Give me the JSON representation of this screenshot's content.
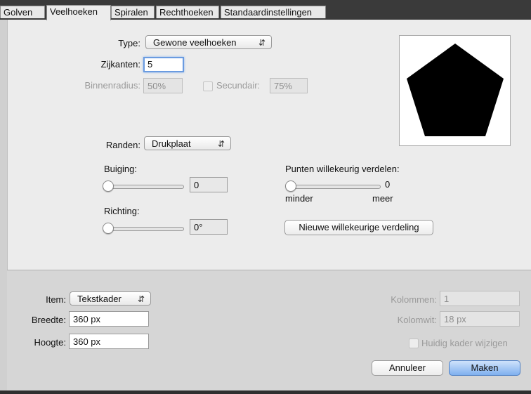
{
  "tabs": [
    {
      "label": "Golven"
    },
    {
      "label": "Veelhoeken"
    },
    {
      "label": "Spiralen"
    },
    {
      "label": "Rechthoeken"
    },
    {
      "label": "Standaardinstellingen"
    }
  ],
  "active_tab": "Veelhoeken",
  "polygon": {
    "type_label": "Type:",
    "type_value": "Gewone veelhoeken",
    "sides_label": "Zijkanten:",
    "sides_value": "5",
    "inner_radius_label": "Binnenradius:",
    "inner_radius_value": "50%",
    "secondary_label": "Secundair:",
    "secondary_value": "75%"
  },
  "edges": {
    "label": "Randen:",
    "value": "Drukplaat",
    "bend_label": "Buiging:",
    "bend_value": "0",
    "direction_label": "Richting:",
    "direction_value": "0°"
  },
  "random": {
    "label": "Punten willekeurig verdelen:",
    "value": "0",
    "min_label": "minder",
    "max_label": "meer",
    "new_button": "Nieuwe willekeurige verdeling"
  },
  "bottom": {
    "item_label": "Item:",
    "item_value": "Tekstkader",
    "width_label": "Breedte:",
    "width_value": "360 px",
    "height_label": "Hoogte:",
    "height_value": "360 px",
    "columns_label": "Kolommen:",
    "columns_value": "1",
    "gutter_label": "Kolomwit:",
    "gutter_value": "18 px",
    "modify_label": "Huidig kader wijzigen",
    "cancel_button": "Annuleer",
    "make_button": "Maken"
  },
  "colors": {
    "accent": "#7fb0ef",
    "preview_shape": "#000000"
  }
}
